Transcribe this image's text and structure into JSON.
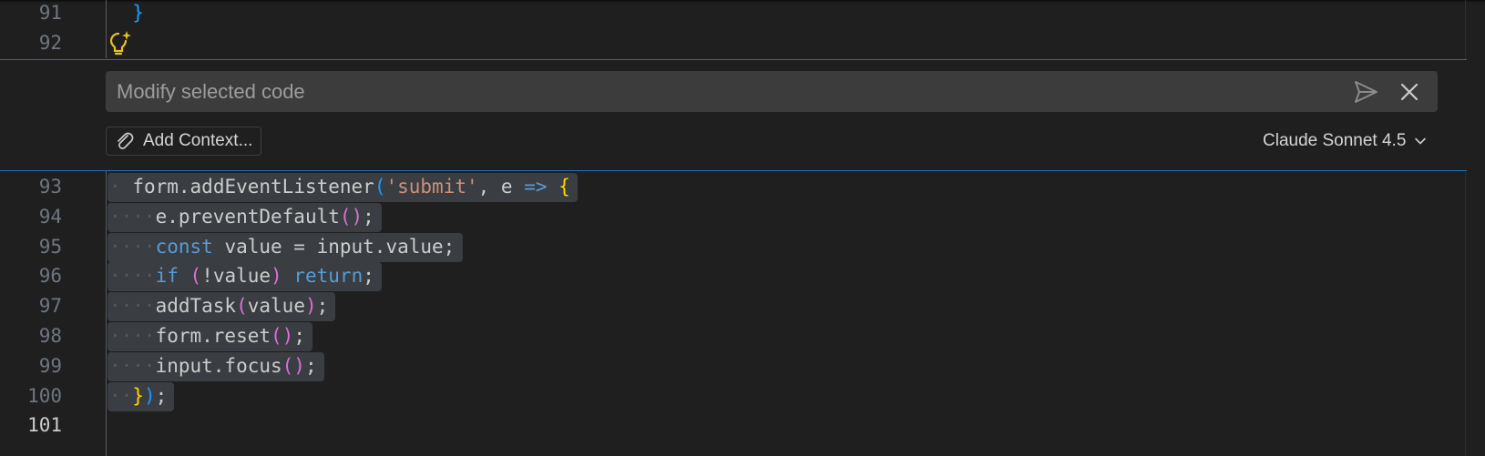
{
  "editor": {
    "lines_above": [
      {
        "number": "91",
        "tokens": [
          {
            "t": "  ",
            "c": "ws-space"
          },
          {
            "t": "}",
            "c": "bluebrace"
          }
        ]
      },
      {
        "number": "92",
        "tokens": []
      }
    ],
    "lines_below": [
      {
        "number": "93",
        "tokens": [
          {
            "t": "·",
            "c": "ws"
          },
          {
            "t": " ",
            "c": "default"
          },
          {
            "t": "form.addEventListener",
            "c": "default"
          },
          {
            "t": "(",
            "c": "bluebrace"
          },
          {
            "t": "'submit'",
            "c": "string"
          },
          {
            "t": ", e ",
            "c": "default"
          },
          {
            "t": "=>",
            "c": "keyword"
          },
          {
            "t": " ",
            "c": "default"
          },
          {
            "t": "{",
            "c": "brace"
          }
        ]
      },
      {
        "number": "94",
        "tokens": [
          {
            "t": "····",
            "c": "ws"
          },
          {
            "t": "e.preventDefault",
            "c": "default"
          },
          {
            "t": "()",
            "c": "paren"
          },
          {
            "t": ";",
            "c": "default"
          }
        ]
      },
      {
        "number": "95",
        "tokens": [
          {
            "t": "····",
            "c": "ws"
          },
          {
            "t": "const",
            "c": "keyword"
          },
          {
            "t": " value = input.value;",
            "c": "default"
          }
        ]
      },
      {
        "number": "96",
        "tokens": [
          {
            "t": "····",
            "c": "ws"
          },
          {
            "t": "if",
            "c": "keyword"
          },
          {
            "t": " ",
            "c": "default"
          },
          {
            "t": "(",
            "c": "paren"
          },
          {
            "t": "!value",
            "c": "default"
          },
          {
            "t": ")",
            "c": "paren"
          },
          {
            "t": " ",
            "c": "default"
          },
          {
            "t": "return",
            "c": "keyword"
          },
          {
            "t": ";",
            "c": "default"
          }
        ]
      },
      {
        "number": "97",
        "tokens": [
          {
            "t": "····",
            "c": "ws"
          },
          {
            "t": "addTask",
            "c": "default"
          },
          {
            "t": "(",
            "c": "paren"
          },
          {
            "t": "value",
            "c": "default"
          },
          {
            "t": ")",
            "c": "paren"
          },
          {
            "t": ";",
            "c": "default"
          }
        ]
      },
      {
        "number": "98",
        "tokens": [
          {
            "t": "····",
            "c": "ws"
          },
          {
            "t": "form.reset",
            "c": "default"
          },
          {
            "t": "()",
            "c": "paren"
          },
          {
            "t": ";",
            "c": "default"
          }
        ]
      },
      {
        "number": "99",
        "tokens": [
          {
            "t": "····",
            "c": "ws"
          },
          {
            "t": "input.focus",
            "c": "default"
          },
          {
            "t": "()",
            "c": "paren"
          },
          {
            "t": ";",
            "c": "default"
          }
        ]
      },
      {
        "number": "100",
        "tokens": [
          {
            "t": "··",
            "c": "ws"
          },
          {
            "t": "}",
            "c": "brace"
          },
          {
            "t": ")",
            "c": "bluebrace"
          },
          {
            "t": ";",
            "c": "default"
          }
        ]
      },
      {
        "number": "101",
        "tokens": [],
        "active": true
      }
    ]
  },
  "inline_chat": {
    "placeholder": "Modify selected code",
    "value": "",
    "send_icon": "send-icon",
    "close_icon": "close-icon",
    "context_label": "Add Context...",
    "context_icon": "paperclip-icon",
    "model_label": "Claude Sonnet 4.5",
    "model_icon": "chevron-down-icon"
  },
  "colors": {
    "background": "#1f1f1f",
    "accent_border": "#1e6fb8",
    "selection": "#3a3d41",
    "keyword": "#569cd6",
    "string": "#ce9178",
    "brace_gold": "#ffd700",
    "paren_magenta": "#da70d6",
    "brace_blue": "#179fff",
    "lightbulb": "#e8c020"
  }
}
